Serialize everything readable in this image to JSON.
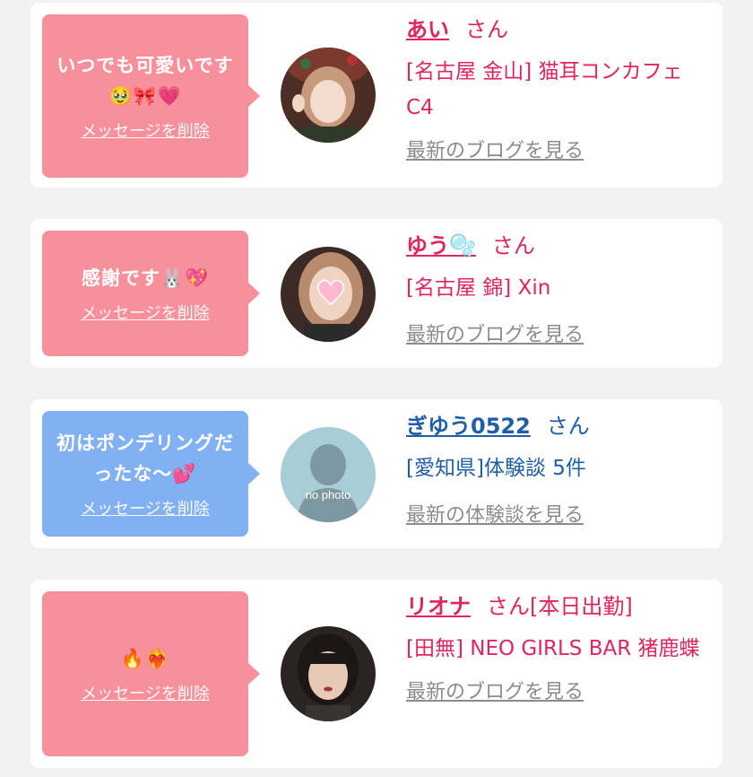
{
  "messages": [
    {
      "message": "いつでも可愛いです🥹🎀💗",
      "delete_label": "メッセージを削除",
      "name": "あい",
      "honorific": "さん",
      "detail": "[名古屋 金山] 猫耳コンカフェ C4",
      "link_label": "最新のブログを見る",
      "bubble_color": "#f7909b",
      "name_color": "#e3245e"
    },
    {
      "message": "感謝です🐰💖",
      "delete_label": "メッセージを削除",
      "name": "ゆう🫧",
      "honorific": "さん",
      "detail": "[名古屋 錦] Xin",
      "link_label": "最新のブログを見る",
      "bubble_color": "#f7909b",
      "name_color": "#e3245e"
    },
    {
      "message": "初はポンデリングだったな〜💕",
      "delete_label": "メッセージを削除",
      "name": "ぎゆう0522",
      "honorific": "さん",
      "avatar_text": "no photo",
      "detail": "[愛知県]体験談 5件",
      "link_label": "最新の体験談を見る",
      "bubble_color": "#82b1f3",
      "name_color": "#1f5fa8"
    },
    {
      "message": "🔥❤️‍🔥",
      "delete_label": "メッセージを削除",
      "name": "リオナ",
      "honorific": "さん",
      "status": "[本日出勤]",
      "detail": "[田無] NEO GIRLS BAR 猪鹿蝶",
      "link_label": "最新のブログを見る",
      "bubble_color": "#f7909b",
      "name_color": "#e3245e"
    }
  ]
}
